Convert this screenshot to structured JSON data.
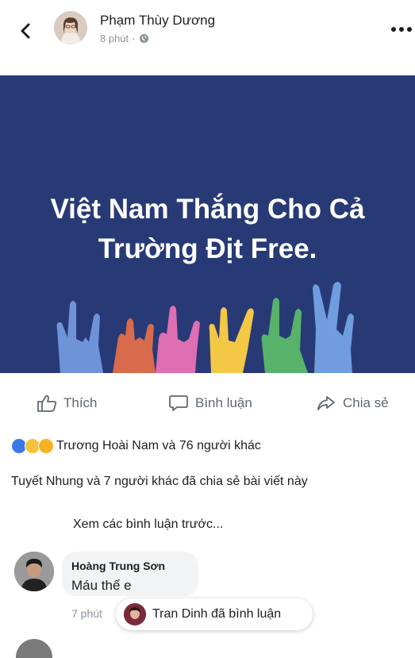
{
  "post": {
    "author": "Phạm Thùy Dương",
    "time": "8 phút",
    "separator": "·",
    "privacy_icon": "globe-icon"
  },
  "banner": {
    "line1": "Việt Nam Thắng Cho Cả",
    "line2": "Trường Địt Free.",
    "background": "#283a76"
  },
  "actions": {
    "like": "Thích",
    "comment": "Bình luận",
    "share": "Chia sẻ"
  },
  "reactions": {
    "icons": [
      "like-icon",
      "haha-icon",
      "wow-icon"
    ],
    "summary": "Trương Hoài Nam và 76 người khác"
  },
  "shares": "Tuyết Nhung và 7 người khác đã chia sẻ bài viết này",
  "view_previous": "Xem các bình luận trước...",
  "comment": {
    "name": "Hoàng Trung Sơn",
    "text": "Máu thế e",
    "time": "7 phút"
  },
  "toast": "Tran Dinh đã bình luận"
}
